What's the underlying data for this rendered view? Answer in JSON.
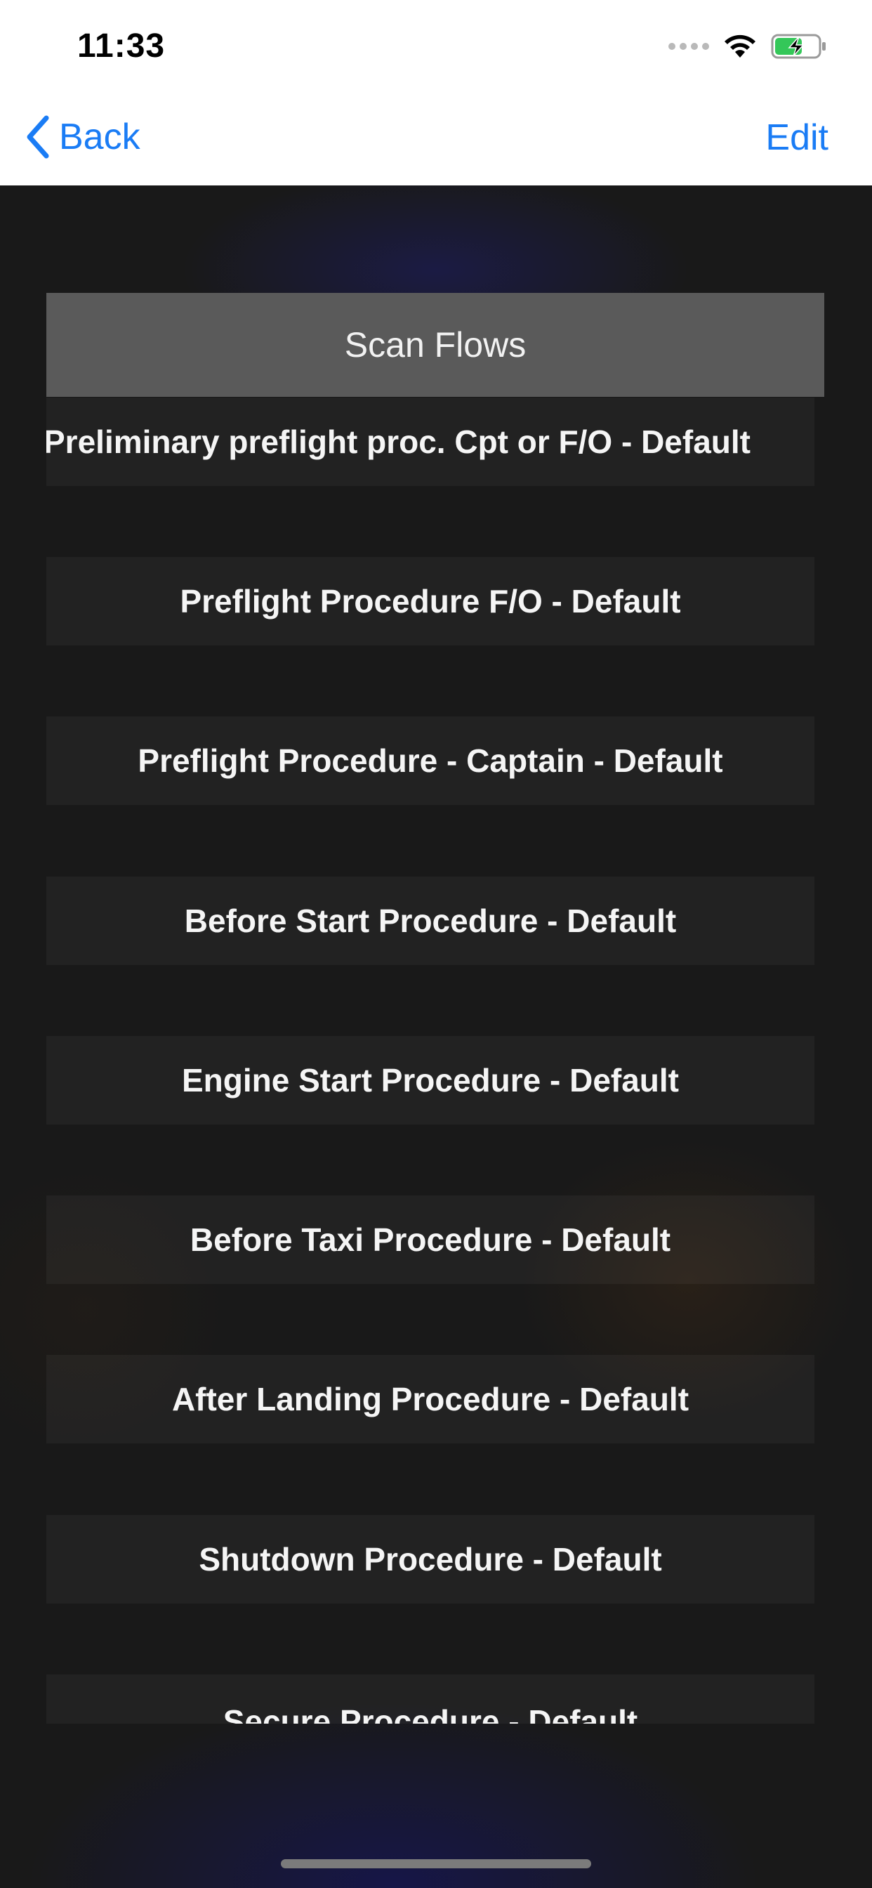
{
  "status_bar": {
    "time": "11:33",
    "icons": [
      "cellular-dots-icon",
      "wifi-icon",
      "battery-charging-icon"
    ],
    "battery_color": "#34c759"
  },
  "nav": {
    "back_label": "Back",
    "edit_label": "Edit",
    "accent_color": "#1a7cf5"
  },
  "section": {
    "title": "Scan Flows"
  },
  "flows": [
    "Preliminary preflight proc. Cpt or F/O - Default",
    "Preflight Procedure F/O - Default",
    "Preflight Procedure - Captain - Default",
    "Before Start Procedure - Default",
    "Engine Start Procedure - Default",
    "Before Taxi Procedure - Default",
    "After Landing Procedure - Default",
    "Shutdown Procedure - Default",
    "Secure Procedure - Default"
  ]
}
